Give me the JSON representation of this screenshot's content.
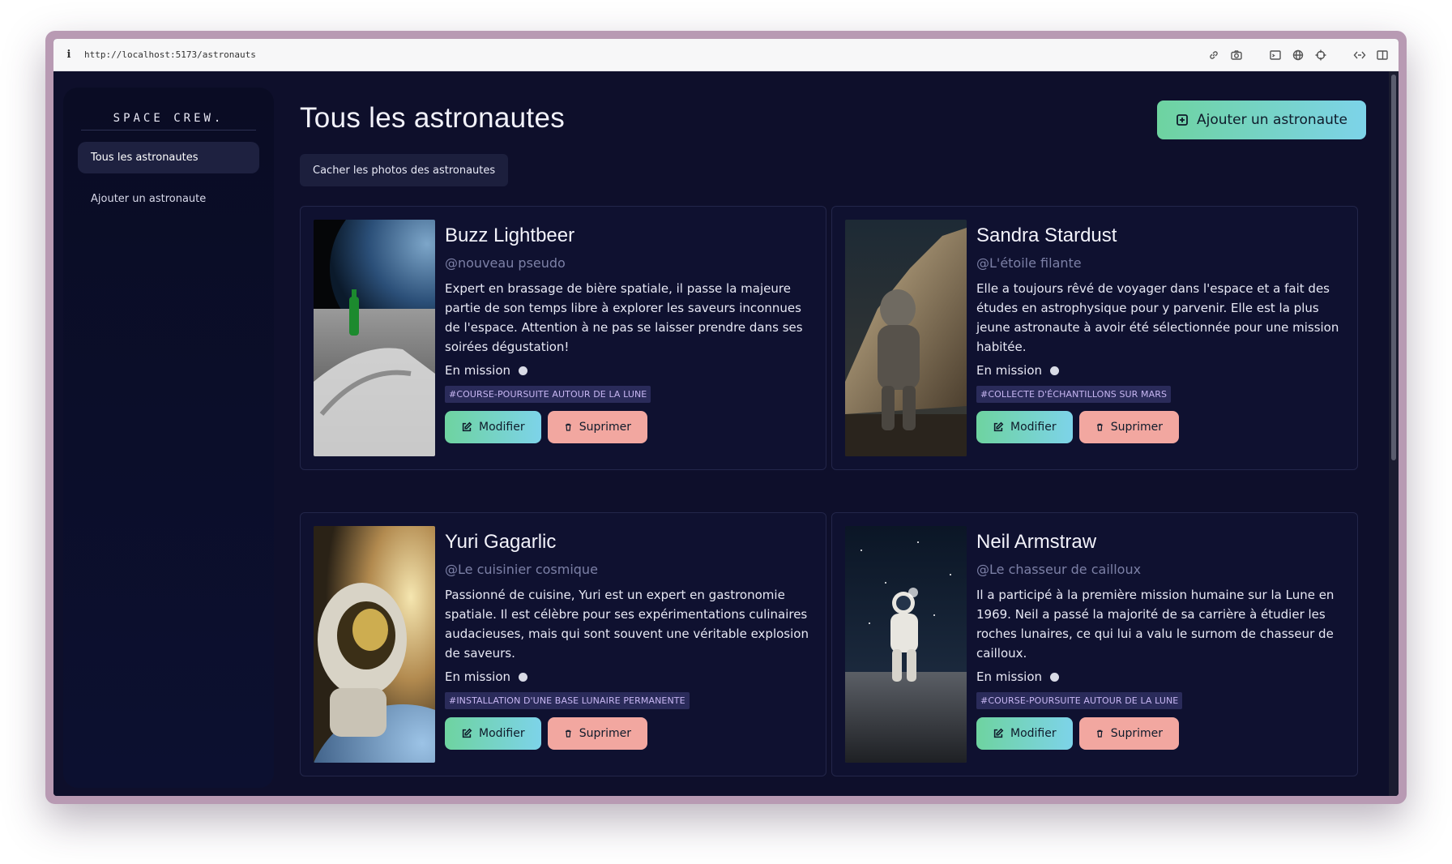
{
  "browser": {
    "url": "http://localhost:5173/astronauts",
    "info_glyph": "i",
    "tool_icons": [
      "link-icon",
      "camera-icon",
      "terminal-icon",
      "globe-icon",
      "crosshair-icon",
      "code-icon",
      "sidebar-toggle-icon"
    ]
  },
  "sidebar": {
    "brand": "SPACE CREW.",
    "items": [
      {
        "label": "Tous les astronautes",
        "active": true
      },
      {
        "label": "Ajouter un astronaute",
        "active": false
      }
    ]
  },
  "header": {
    "title": "Tous les astronautes",
    "add_button": "Ajouter un astronaute",
    "toggle_photos": "Cacher les photos des astronautes"
  },
  "colors": {
    "accent_gradient_start": "#6ed3a0",
    "accent_gradient_end": "#7dd3e9",
    "delete": "#f2a7a0",
    "background": "#0e0f2b"
  },
  "astronauts": [
    {
      "name": "Buzz Lightbeer",
      "pseudo": "@nouveau pseudo",
      "description": "Expert en brassage de bière spatiale, il passe la majeure partie de son temps libre à explorer les saveurs inconnues de l'espace. Attention à ne pas se laisser prendre dans ses soirées dégustation!",
      "status": "En mission",
      "mission": "#COURSE-POURSUITE AUTOUR DE LA LUNE",
      "edit": "Modifier",
      "delete": "Suprimer"
    },
    {
      "name": "Sandra Stardust",
      "pseudo": "@L'étoile filante",
      "description": "Elle a toujours rêvé de voyager dans l'espace et a fait des études en astrophysique pour y parvenir. Elle est la plus jeune astronaute à avoir été sélectionnée pour une mission habitée.",
      "status": "En mission",
      "mission": "#COLLECTE D'ÉCHANTILLONS SUR MARS",
      "edit": "Modifier",
      "delete": "Suprimer"
    },
    {
      "name": "Yuri Gagarlic",
      "pseudo": "@Le cuisinier cosmique",
      "description": "Passionné de cuisine, Yuri est un expert en gastronomie spatiale. Il est célèbre pour ses expérimentations culinaires audacieuses, mais qui sont souvent une véritable explosion de saveurs.",
      "status": "En mission",
      "mission": "#INSTALLATION D'UNE BASE LUNAIRE PERMANENTE",
      "edit": "Modifier",
      "delete": "Suprimer"
    },
    {
      "name": "Neil Armstraw",
      "pseudo": "@Le chasseur de cailloux",
      "description": "Il a participé à la première mission humaine sur la Lune en 1969. Neil a passé la majorité de sa carrière à étudier les roches lunaires, ce qui lui a valu le surnom de chasseur de cailloux.",
      "status": "En mission",
      "mission": "#COURSE-POURSUITE AUTOUR DE LA LUNE",
      "edit": "Modifier",
      "delete": "Suprimer"
    }
  ]
}
